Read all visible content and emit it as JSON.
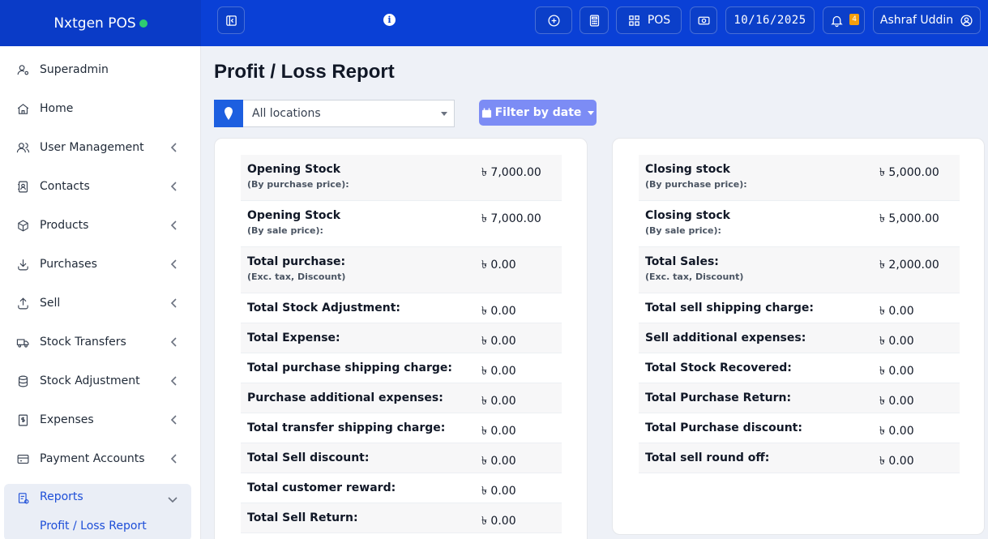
{
  "brand": {
    "name": "Nxtgen POS",
    "status_color": "#2ecc71"
  },
  "topbar": {
    "pos_label": "POS",
    "date": "10/16/2025",
    "notification_count": "4",
    "user_name": "Ashraf Uddin"
  },
  "sidebar": {
    "items": [
      {
        "label": "Superadmin",
        "icon": "user-cog-icon"
      },
      {
        "label": "Home",
        "icon": "home-icon"
      },
      {
        "label": "User Management",
        "icon": "users-icon"
      },
      {
        "label": "Contacts",
        "icon": "contacts-icon"
      },
      {
        "label": "Products",
        "icon": "box-icon"
      },
      {
        "label": "Purchases",
        "icon": "download-icon"
      },
      {
        "label": "Sell",
        "icon": "upload-icon"
      },
      {
        "label": "Stock Transfers",
        "icon": "truck-icon"
      },
      {
        "label": "Stock Adjustment",
        "icon": "database-icon"
      },
      {
        "label": "Expenses",
        "icon": "receipt-icon"
      },
      {
        "label": "Payment Accounts",
        "icon": "credit-card-icon"
      },
      {
        "label": "Reports",
        "icon": "report-icon"
      }
    ],
    "active_sub": "Profit / Loss Report"
  },
  "main": {
    "title": "Profit / Loss Report",
    "location_select": "All locations",
    "filter_label": "Filter by date"
  },
  "left_report": [
    {
      "label": "Opening Stock",
      "sub": "(By purchase price):",
      "value": "৳ 7,000.00"
    },
    {
      "label": "Opening Stock",
      "sub": "(By sale price):",
      "value": "৳ 7,000.00"
    },
    {
      "label": "Total purchase:",
      "sub": "(Exc. tax, Discount)",
      "value": "৳ 0.00"
    },
    {
      "label": "Total Stock Adjustment:",
      "sub": "",
      "value": "৳ 0.00"
    },
    {
      "label": "Total Expense:",
      "sub": "",
      "value": "৳ 0.00"
    },
    {
      "label": "Total purchase shipping charge:",
      "sub": "",
      "value": "৳ 0.00"
    },
    {
      "label": "Purchase additional expenses:",
      "sub": "",
      "value": "৳ 0.00"
    },
    {
      "label": "Total transfer shipping charge:",
      "sub": "",
      "value": "৳ 0.00"
    },
    {
      "label": "Total Sell discount:",
      "sub": "",
      "value": "৳ 0.00"
    },
    {
      "label": "Total customer reward:",
      "sub": "",
      "value": "৳ 0.00"
    },
    {
      "label": "Total Sell Return:",
      "sub": "",
      "value": "৳ 0.00"
    }
  ],
  "right_report": [
    {
      "label": "Closing stock",
      "sub": "(By purchase price):",
      "value": "৳ 5,000.00"
    },
    {
      "label": "Closing stock",
      "sub": "(By sale price):",
      "value": "৳ 5,000.00"
    },
    {
      "label": "Total Sales:",
      "sub": "(Exc. tax, Discount)",
      "value": "৳ 2,000.00"
    },
    {
      "label": "Total sell shipping charge:",
      "sub": "",
      "value": "৳ 0.00"
    },
    {
      "label": "Sell additional expenses:",
      "sub": "",
      "value": "৳ 0.00"
    },
    {
      "label": "Total Stock Recovered:",
      "sub": "",
      "value": "৳ 0.00"
    },
    {
      "label": "Total Purchase Return:",
      "sub": "",
      "value": "৳ 0.00"
    },
    {
      "label": "Total Purchase discount:",
      "sub": "",
      "value": "৳ 0.00"
    },
    {
      "label": "Total sell round off:",
      "sub": "",
      "value": "৳ 0.00"
    }
  ]
}
